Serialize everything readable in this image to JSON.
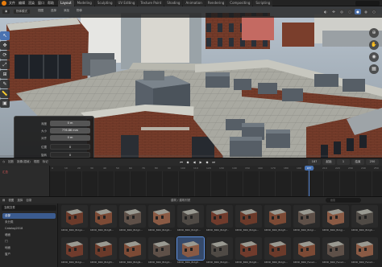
{
  "app": {
    "menus": [
      "文件",
      "编辑",
      "渲染",
      "窗口",
      "帮助"
    ],
    "workspaces": [
      "Layout",
      "Modeling",
      "Sculpting",
      "UV Editing",
      "Texture Paint",
      "Shading",
      "Animation",
      "Rendering",
      "Compositing",
      "Scripting"
    ],
    "active_workspace": "Layout"
  },
  "viewport": {
    "mode_dropdown": "物体模式",
    "view_menu": "视图",
    "select_menu": "选择",
    "add_menu": "添加",
    "object_menu": "物体",
    "tools": [
      "cursor-icon",
      "move-icon",
      "rotate-icon",
      "scale-icon",
      "transform-icon",
      "annotate-icon",
      "measure-icon",
      "add-cube-icon"
    ],
    "active_tool_index": 0
  },
  "op_panel": {
    "rows": [
      {
        "label": "深度",
        "value": "0 m"
      },
      {
        "label": "大小",
        "value": "776.86 mm"
      },
      {
        "label": "对齐",
        "value": "0 m"
      },
      {
        "label": "位置",
        "value": "0"
      },
      {
        "label": "旋转",
        "value": "0"
      }
    ]
  },
  "timeline": {
    "menus": [
      "回放",
      "抠像(插帧)",
      "视图",
      "标记"
    ],
    "channel": "汇总",
    "current_frame": "187",
    "start_label": "起始",
    "start": "1",
    "end_label": "结束",
    "end": "250",
    "ticks": [
      "0",
      "10",
      "20",
      "30",
      "40",
      "50",
      "60",
      "70",
      "80",
      "90",
      "100",
      "110",
      "120",
      "130",
      "140",
      "150",
      "160",
      "170",
      "180",
      "190",
      "200",
      "210",
      "220",
      "230",
      "240",
      "250"
    ]
  },
  "asset_browser": {
    "menus": [
      "视图",
      "选择",
      "目录"
    ],
    "library": "当前文件",
    "breadcrumb": "建筑 / 建筑材质",
    "search_placeholder": "搜索",
    "categories": [
      "全部",
      "未分类",
      "Catalog2018",
      "墙面",
      "门",
      "地面",
      "窗户"
    ],
    "selected_category_index": 0,
    "assets": [
      "KB3D_BRK_BldgA...",
      "KB3D_BRK_BldgB...",
      "KB3D_BRK_BldgC...",
      "KB3D_BRK_BldgD...",
      "KB3D_BRK_BldgE...",
      "KB3D_BRK_BldgF...",
      "KB3D_BRK_BldgG...",
      "KB3D_BRK_BldgH...",
      "KB3D_BRK_BldgI...",
      "KB3D_BRK_BldgJ...",
      "KB3D_BRK_BldgK...",
      "KB3D_BRK_BldgL...",
      "KB3D_BRK_BldgM...",
      "KB3D_BRK_BldgN...",
      "KB3D_BRK_BldgO...",
      "KB3D_BRK_BldgP...",
      "KB3D_BRK_BldgQ...",
      "KB3D_BRK_BldgR...",
      "KB3D_BRK_BldgS...",
      "KB3D_BRK_Facad...",
      "KB3D_BRK_Facad...",
      "KB3D_BRK_Facad..."
    ],
    "selected_asset_index": 15
  },
  "colors": {
    "accent": "#4772b3",
    "brand": "#e87d0d",
    "keyframe_channel": "#e25a5a"
  }
}
